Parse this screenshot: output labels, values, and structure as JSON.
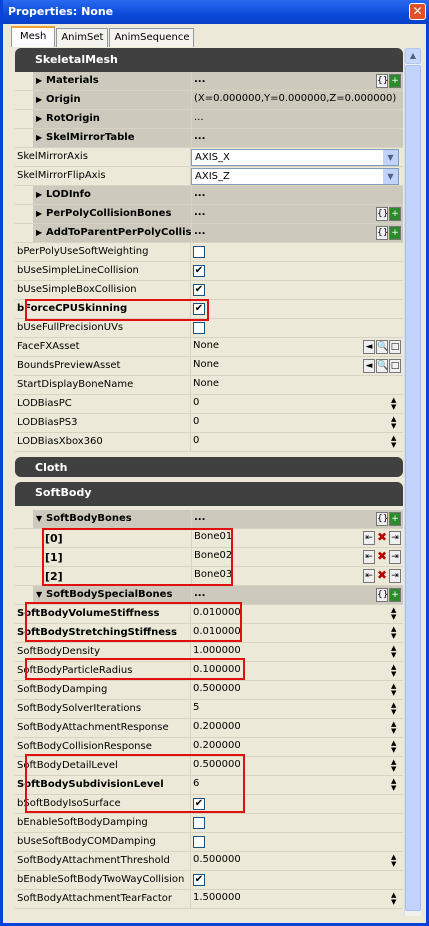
{
  "window": {
    "title": "Properties: None",
    "close": "✕"
  },
  "tabs": [
    "Mesh",
    "AnimSet",
    "AnimSequence"
  ],
  "sections": {
    "skeletal": "SkeletalMesh",
    "cloth": "Cloth",
    "softbody": "SoftBody"
  },
  "skeletal_rows": [
    {
      "t": "cat",
      "label": "Materials",
      "value": "...",
      "icons": "array",
      "bold": true
    },
    {
      "t": "cat",
      "label": "Origin",
      "value": "(X=0.000000,Y=0.000000,Z=0.000000)",
      "plain": true
    },
    {
      "t": "cat",
      "label": "RotOrigin",
      "value": "...",
      "plain": true
    },
    {
      "t": "cat",
      "label": "SkelMirrorTable",
      "value": "...",
      "bold": true
    },
    {
      "t": "combo",
      "label": "SkelMirrorAxis",
      "value": "AXIS_X"
    },
    {
      "t": "combo",
      "label": "SkelMirrorFlipAxis",
      "value": "AXIS_Z"
    },
    {
      "t": "cat",
      "label": "LODInfo",
      "value": "...",
      "bold": true
    },
    {
      "t": "cat",
      "label": "PerPolyCollisionBones",
      "value": "...",
      "icons": "array",
      "bold": true
    },
    {
      "t": "cat",
      "label": "AddToParentPerPolyCollisionBone",
      "value": "...",
      "icons": "array",
      "bold": true
    },
    {
      "t": "chk",
      "label": "bPerPolyUseSoftWeighting",
      "checked": false
    },
    {
      "t": "chk",
      "label": "bUseSimpleLineCollision",
      "checked": true
    },
    {
      "t": "chk",
      "label": "bUseSimpleBoxCollision",
      "checked": true
    },
    {
      "t": "chk",
      "label": "bForceCPUSkinning",
      "checked": true,
      "bold": true
    },
    {
      "t": "chk",
      "label": "bUseFullPrecisionUVs",
      "checked": false
    },
    {
      "t": "item",
      "label": "FaceFXAsset",
      "value": "None",
      "icons": "asset"
    },
    {
      "t": "item",
      "label": "BoundsPreviewAsset",
      "value": "None",
      "icons": "asset"
    },
    {
      "t": "item",
      "label": "StartDisplayBoneName",
      "value": "None"
    },
    {
      "t": "item",
      "label": "LODBiasPC",
      "value": "0",
      "spin": true
    },
    {
      "t": "item",
      "label": "LODBiasPS3",
      "value": "0",
      "spin": true
    },
    {
      "t": "item",
      "label": "LODBiasXbox360",
      "value": "0",
      "spin": true
    }
  ],
  "softbody_rows": [
    {
      "t": "cat",
      "label": "SoftBodyBones",
      "value": "...",
      "icons": "array",
      "open": true,
      "bold": true
    },
    {
      "t": "elem",
      "label": "[0]",
      "value": "Bone01",
      "icons": "elem"
    },
    {
      "t": "elem",
      "label": "[1]",
      "value": "Bone02",
      "icons": "elem"
    },
    {
      "t": "elem",
      "label": "[2]",
      "value": "Bone03",
      "icons": "elem"
    },
    {
      "t": "cat",
      "label": "SoftBodySpecialBones",
      "value": "...",
      "icons": "array",
      "open": true,
      "bold": true
    },
    {
      "t": "item",
      "label": "SoftBodyVolumeStiffness",
      "value": "0.010000",
      "spin": true,
      "bold": true
    },
    {
      "t": "item",
      "label": "SoftBodyStretchingStiffness",
      "value": "0.010000",
      "spin": true,
      "bold": true
    },
    {
      "t": "item",
      "label": "SoftBodyDensity",
      "value": "1.000000",
      "spin": true
    },
    {
      "t": "item",
      "label": "SoftBodyParticleRadius",
      "value": "0.100000",
      "spin": true
    },
    {
      "t": "item",
      "label": "SoftBodyDamping",
      "value": "0.500000",
      "spin": true
    },
    {
      "t": "item",
      "label": "SoftBodySolverIterations",
      "value": "5",
      "spin": true
    },
    {
      "t": "item",
      "label": "SoftBodyAttachmentResponse",
      "value": "0.200000",
      "spin": true
    },
    {
      "t": "item",
      "label": "SoftBodyCollisionResponse",
      "value": "0.200000",
      "spin": true
    },
    {
      "t": "item",
      "label": "SoftBodyDetailLevel",
      "value": "0.500000",
      "spin": true
    },
    {
      "t": "item",
      "label": "SoftBodySubdivisionLevel",
      "value": "6",
      "spin": true,
      "bold": true
    },
    {
      "t": "chk",
      "label": "bSoftBodyIsoSurface",
      "checked": true
    },
    {
      "t": "chk",
      "label": "bEnableSoftBodyDamping",
      "checked": false
    },
    {
      "t": "chk",
      "label": "bUseSoftBodyCOMDamping",
      "checked": false
    },
    {
      "t": "item",
      "label": "SoftBodyAttachmentThreshold",
      "value": "0.500000",
      "spin": true
    },
    {
      "t": "chk",
      "label": "bEnableSoftBodyTwoWayCollision",
      "checked": true
    },
    {
      "t": "item",
      "label": "SoftBodyAttachmentTearFactor",
      "value": "1.500000",
      "spin": true
    }
  ]
}
